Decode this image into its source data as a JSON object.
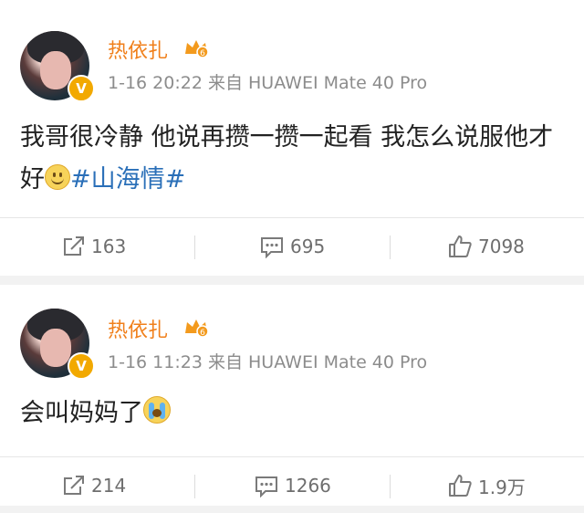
{
  "posts": [
    {
      "author": "热依扎",
      "verified_badge": "V",
      "timestamp": "1-16 20:22",
      "source": "来自 HUAWEI Mate 40 Pro",
      "text_before": "我哥很冷静 他说再攒一攒一起看 我怎么说服他才好",
      "emoji": "smile-emoji",
      "topic": "#山海情#",
      "reposts": "163",
      "comments": "695",
      "likes": "7098"
    },
    {
      "author": "热依扎",
      "verified_badge": "V",
      "timestamp": "1-16 11:23",
      "source": "来自 HUAWEI Mate 40 Pro",
      "text_before": "会叫妈妈了",
      "emoji": "crying-emoji",
      "reposts": "214",
      "comments": "1266",
      "likes": "1.9万"
    }
  ],
  "colors": {
    "name": "#f07f1a",
    "topic": "#2a6fb8",
    "meta": "#8c8c8c",
    "background": "#f2f2f2"
  },
  "icons": [
    "repost-icon",
    "comment-icon",
    "like-icon",
    "crown-badge-icon"
  ]
}
